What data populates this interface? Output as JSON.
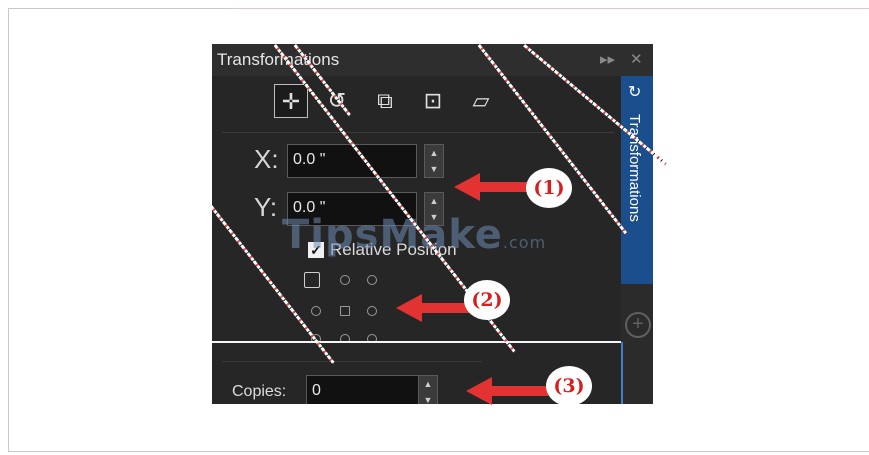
{
  "panel": {
    "title": "Transformations",
    "side_tab_label": "Transformations",
    "tools": [
      "position-tool",
      "rotate-tool",
      "scale-tool",
      "size-tool",
      "skew-tool"
    ],
    "x": {
      "label": "X:",
      "value": "0.0 \""
    },
    "y": {
      "label": "Y:",
      "value": "0.0 \""
    },
    "relative_position": {
      "label": "Relative Position",
      "checked": true
    },
    "copies": {
      "label": "Copies:",
      "value": "0"
    }
  },
  "watermark": {
    "text": "TipsMake",
    "suffix": ".com"
  },
  "callouts": [
    {
      "label": "(1)"
    },
    {
      "label": "(2)"
    },
    {
      "label": "(3)"
    }
  ],
  "colors": {
    "accent": "#1b4e8c",
    "arrow": "#e33232",
    "panel_bg": "#262626"
  }
}
